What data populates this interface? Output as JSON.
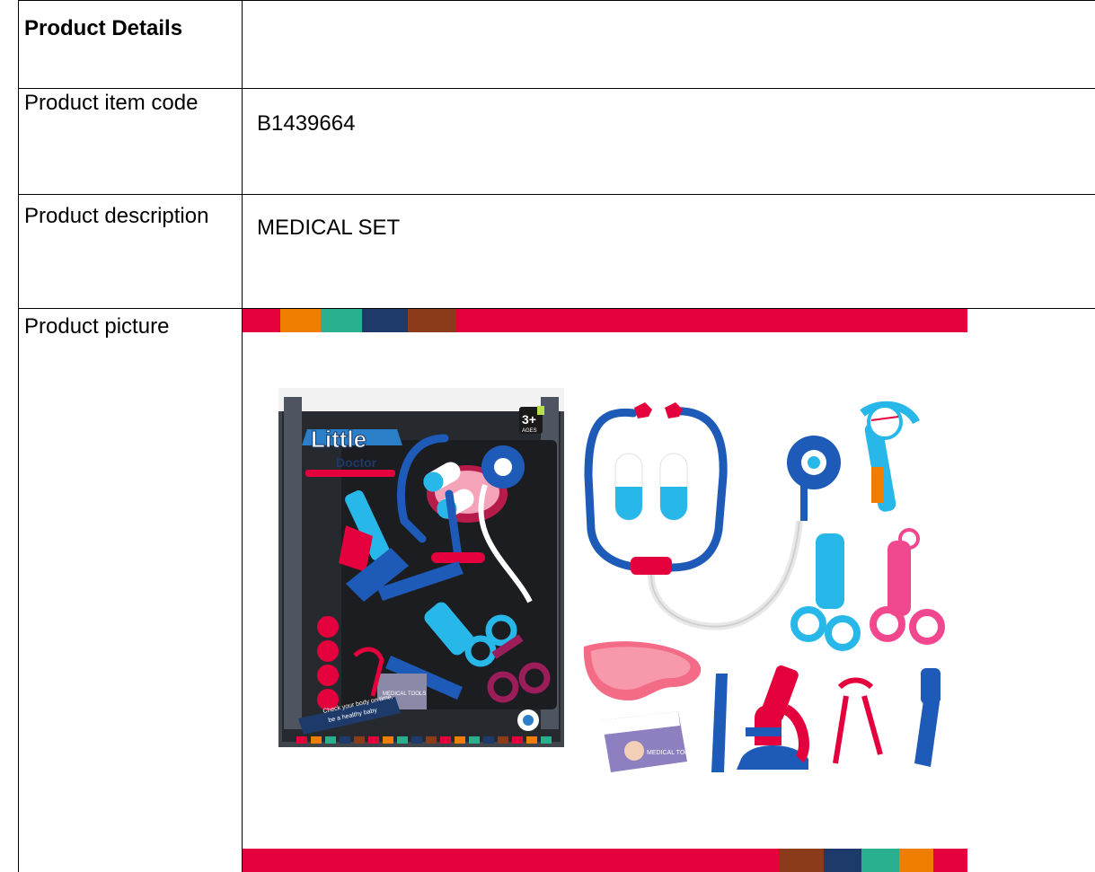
{
  "table": {
    "header": {
      "label": "Product Details",
      "value": ""
    },
    "rows": [
      {
        "label": "Product  item code",
        "value": "B1439664"
      },
      {
        "label": "Product  description",
        "value": "MEDICAL SET"
      },
      {
        "label": "Product  picture"
      }
    ]
  },
  "picture": {
    "box_brand": "Little",
    "box_subbrand": "Doctor",
    "box_age": "3+",
    "box_age_unit": "AGES",
    "box_slogan_1": "Check your body on time,",
    "box_slogan_2": "be a healthy baby",
    "box_card_text": "MEDICAL TOOLS",
    "card_text": "MEDICAL TOOLS",
    "colors": {
      "red": "#e4003c",
      "orange": "#ef7d00",
      "teal": "#2ab08e",
      "navy": "#1d3a6b",
      "brown": "#8b3a1a",
      "blue": "#1e5ab8",
      "cyan": "#27b7e8",
      "pink": "#f0478e",
      "tray_pink": "#f36b86"
    }
  }
}
